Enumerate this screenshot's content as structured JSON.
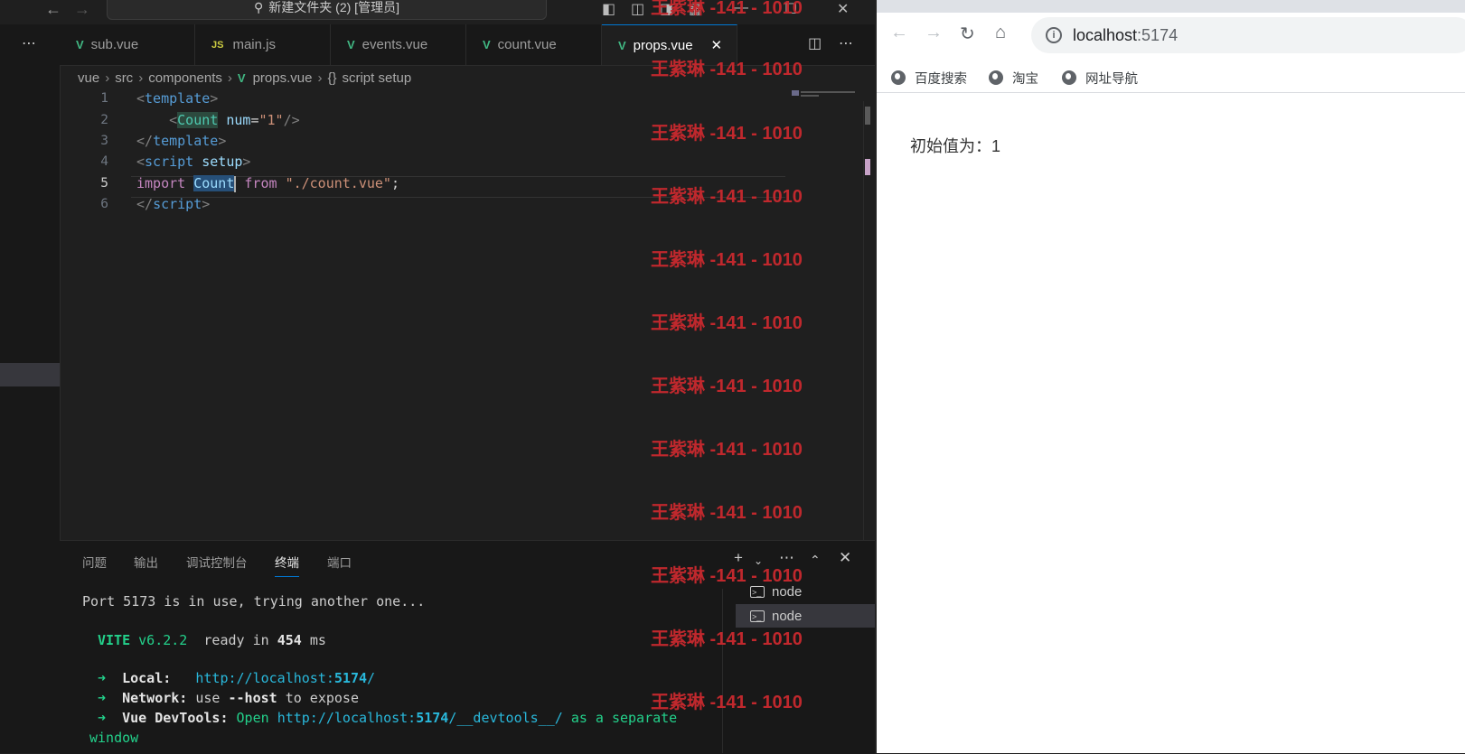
{
  "vscode": {
    "title": "新建文件夹 (2) [管理员]",
    "tabs": [
      {
        "label": "sub.vue",
        "icon": "vue"
      },
      {
        "label": "main.js",
        "icon": "js"
      },
      {
        "label": "events.vue",
        "icon": "vue"
      },
      {
        "label": "count.vue",
        "icon": "vue"
      },
      {
        "label": "props.vue",
        "icon": "vue",
        "active": true
      }
    ],
    "js_badge": "JS",
    "breadcrumb": [
      "vue",
      "src",
      "components",
      "props.vue",
      "script setup"
    ],
    "code_line_numbers": [
      "1",
      "2",
      "3",
      "4",
      "5",
      "6"
    ],
    "current_line": "5",
    "panel_tabs": [
      "问题",
      "输出",
      "调试控制台",
      "终端",
      "端口"
    ],
    "active_panel_tab": "终端",
    "terminal_lines": {
      "line1": "Port 5173 is in use, trying another one...",
      "vite": "VITE",
      "vite_version": "v6.2.2",
      "ready": "ready in",
      "ready_ms": "454",
      "ms": "ms",
      "local_label": "Local:",
      "local_url_pre": "http://localhost:",
      "local_port": "5174",
      "local_url_post": "/",
      "network_label": "Network:",
      "network_use": "use",
      "network_flag": "--host",
      "network_post": "to expose",
      "devtools_label": "Vue DevTools:",
      "devtools_open": "Open",
      "devtools_url_pre": "http://localhost:",
      "devtools_port": "5174",
      "devtools_url_post": "/__devtools__/",
      "devtools_tail": "as a separate",
      "devtools_wrap": "window"
    },
    "terminal_instances": [
      "node",
      "node"
    ]
  },
  "watermark": "王紫琳 -141 - 1010",
  "browser": {
    "address_host": "localhost",
    "address_port": ":5174",
    "bookmarks": [
      "百度搜索",
      "淘宝",
      "网址导航"
    ],
    "page_text": "初始值为：1"
  },
  "colors": {
    "accent": "#0078d4",
    "vue_green": "#41b883",
    "watermark": "#c0282d"
  }
}
